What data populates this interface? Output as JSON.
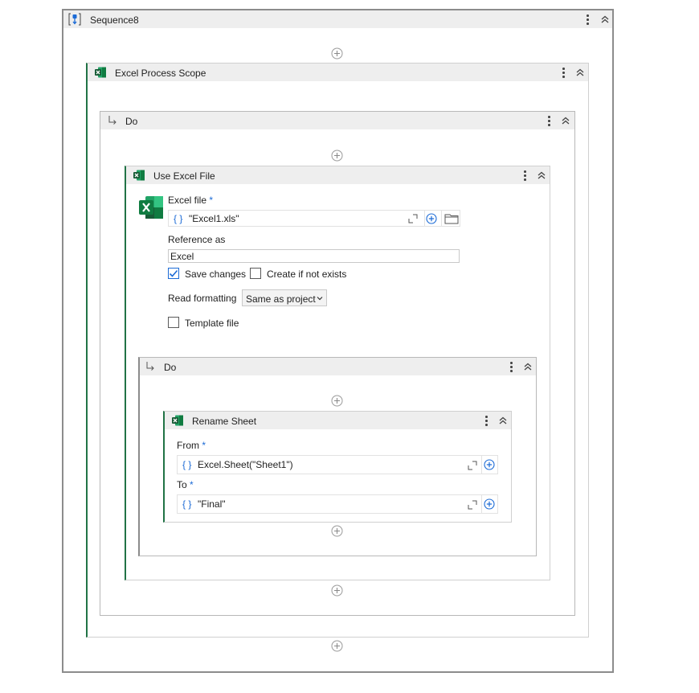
{
  "sequence": {
    "title": "Sequence8"
  },
  "excel_scope": {
    "title": "Excel Process Scope"
  },
  "do_outer": {
    "title": "Do"
  },
  "use_excel": {
    "title": "Use Excel File",
    "excel_file_label": "Excel file",
    "required_mark": "*",
    "excel_file_value": "\"Excel1.xls\"",
    "reference_label": "Reference as",
    "reference_value": "Excel",
    "save_changes_label": "Save changes",
    "save_changes_checked": true,
    "create_if_not_exists_label": "Create if not exists",
    "create_if_not_exists_checked": false,
    "read_formatting_label": "Read formatting",
    "read_formatting_value": "Same as project",
    "template_file_label": "Template file",
    "template_file_checked": false
  },
  "do_inner": {
    "title": "Do"
  },
  "rename_sheet": {
    "title": "Rename Sheet",
    "from_label": "From",
    "from_value": "Excel.Sheet(\"Sheet1\")",
    "to_label": "To",
    "to_value": "\"Final\"",
    "required_mark": "*"
  },
  "icons": {
    "curly": "{ }",
    "excel": "X",
    "sequence": "sequence-icon",
    "do_arrow": "↳"
  },
  "colors": {
    "accent_green": "#217346",
    "accent_blue": "#1c6bd6",
    "header_bg": "#eeeeee"
  }
}
